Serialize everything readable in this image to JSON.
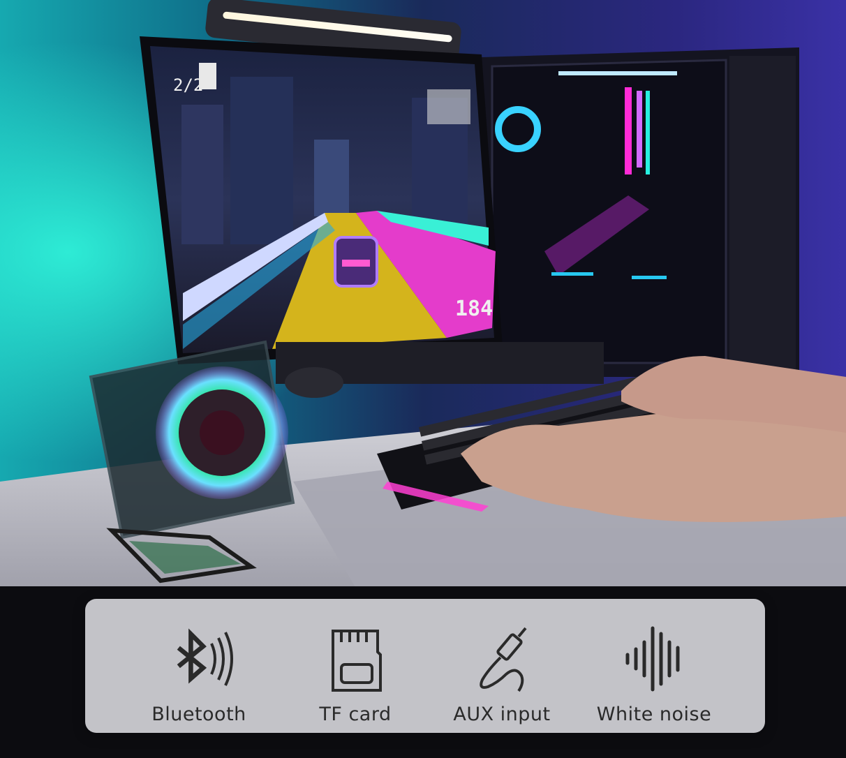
{
  "colors": {
    "wall_left": "#1fc8c4",
    "wall_right": "#3a2f9a",
    "desk": "#cfcfd6",
    "neon_magenta": "#ff2bd6",
    "neon_cyan": "#27f0e0",
    "neon_yellow": "#e2c21a",
    "panel_text": "#2a2a2a"
  },
  "game_hud": {
    "lap": "2/2",
    "speed": "184"
  },
  "features": [
    {
      "label": "Bluetooth",
      "icon": "bluetooth-icon"
    },
    {
      "label": "TF card",
      "icon": "tf-card-icon"
    },
    {
      "label": "AUX input",
      "icon": "aux-cable-icon"
    },
    {
      "label": "White noise",
      "icon": "sound-wave-icon"
    }
  ]
}
